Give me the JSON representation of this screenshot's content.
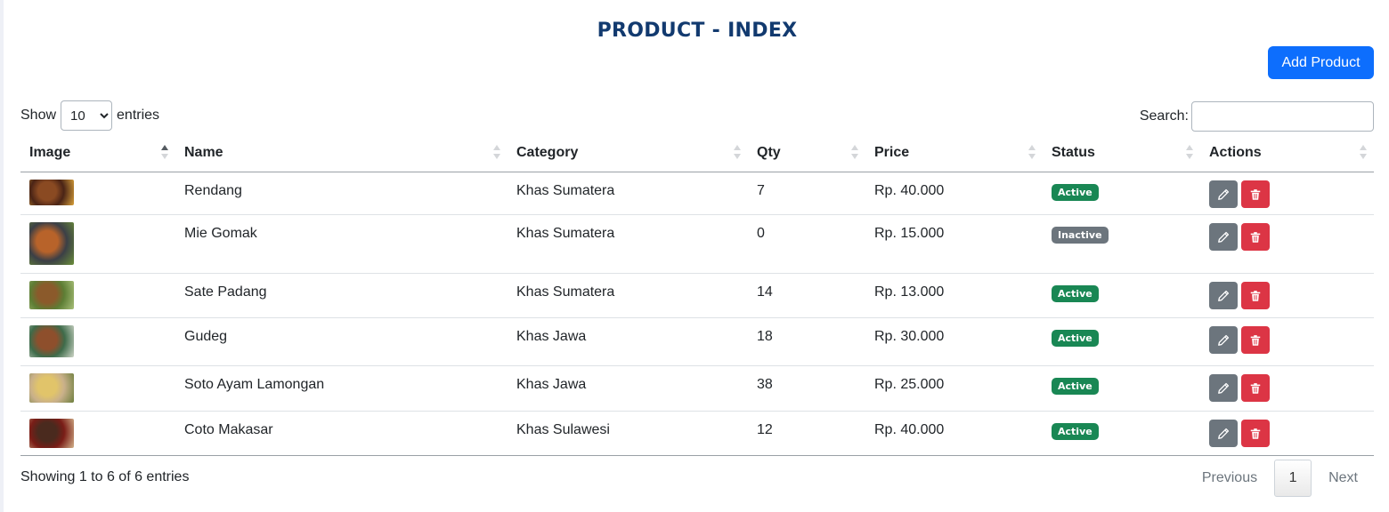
{
  "page": {
    "title": "PRODUCT - INDEX",
    "add_label": "Add Product"
  },
  "controls": {
    "show_label": "Show",
    "entries_label": "entries",
    "page_length": "10",
    "search_label": "Search:",
    "search_value": ""
  },
  "table": {
    "columns": [
      "Image",
      "Name",
      "Category",
      "Qty",
      "Price",
      "Status",
      "Actions"
    ],
    "sorted_column": "Image",
    "sort_direction": "ascending",
    "rows": [
      {
        "image": "rendang-photo",
        "name": "Rendang",
        "category": "Khas Sumatera",
        "qty": "7",
        "price": "Rp. 40.000",
        "status": "Active"
      },
      {
        "image": "mie-gomak-photo",
        "name": "Mie Gomak",
        "category": "Khas Sumatera",
        "qty": "0",
        "price": "Rp. 15.000",
        "status": "Inactive"
      },
      {
        "image": "sate-padang-photo",
        "name": "Sate Padang",
        "category": "Khas Sumatera",
        "qty": "14",
        "price": "Rp. 13.000",
        "status": "Active"
      },
      {
        "image": "gudeg-photo",
        "name": "Gudeg",
        "category": "Khas Jawa",
        "qty": "18",
        "price": "Rp. 30.000",
        "status": "Active"
      },
      {
        "image": "soto-ayam-photo",
        "name": "Soto Ayam Lamongan",
        "category": "Khas Jawa",
        "qty": "38",
        "price": "Rp. 25.000",
        "status": "Active"
      },
      {
        "image": "coto-makasar-photo",
        "name": "Coto Makasar",
        "category": "Khas Sulawesi",
        "qty": "12",
        "price": "Rp. 40.000",
        "status": "Active"
      }
    ]
  },
  "footer": {
    "info": "Showing 1 to 6 of 6 entries",
    "previous_label": "Previous",
    "current_page": "1",
    "next_label": "Next"
  },
  "icons": {
    "edit": "pencil-icon",
    "delete": "trash-icon"
  },
  "colors": {
    "title": "#123a6f",
    "primary": "#0d6efd",
    "active_badge": "#198754",
    "inactive_badge": "#6c757d",
    "edit_button": "#6c757d",
    "delete_button": "#dc3545"
  }
}
